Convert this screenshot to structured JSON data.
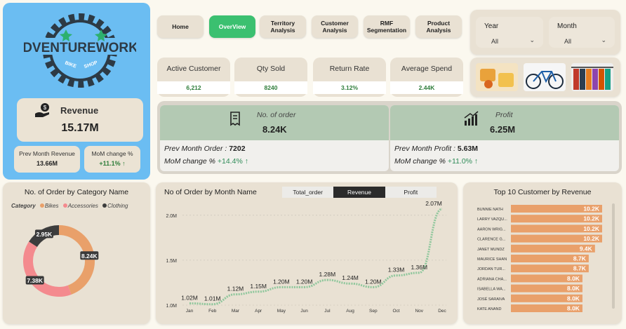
{
  "brand": {
    "logo_text": "ADVENTUREWORKS",
    "logo_sub_left": "BIKE",
    "logo_sub_right": "SHOP",
    "revenue_label": "Revenue",
    "revenue_value": "15.17M",
    "prev_month_label": "Prev Month Revenue",
    "prev_month_value": "13.66M",
    "mom_label": "MoM change %",
    "mom_value": "+11.1%",
    "mom_arrow": "↑"
  },
  "nav": [
    {
      "label": "Home"
    },
    {
      "label": "OverView"
    },
    {
      "label": "Territory Analysis"
    },
    {
      "label": "Customer Analysis"
    },
    {
      "label": "RMF Segmentation"
    },
    {
      "label": "Product Analysis"
    }
  ],
  "slicers": {
    "year_label": "Year",
    "year_value": "All",
    "month_label": "Month",
    "month_value": "All",
    "chevron": "⌄"
  },
  "kpis": [
    {
      "label": "Active Customer",
      "value": "6,212"
    },
    {
      "label": "Qty Sold",
      "value": "8240"
    },
    {
      "label": "Return Rate",
      "value": "3.12%"
    },
    {
      "label": "Average Spend",
      "value": "2.44K"
    }
  ],
  "orders": {
    "label": "No. of order",
    "value": "8.24K",
    "prev_label": "Prev Month Order :",
    "prev_value": "7202",
    "mom_label": "MoM change %",
    "mom_value": "+14.4%",
    "arrow": "↑"
  },
  "profit": {
    "label": "Profit",
    "value": "6.25M",
    "prev_label": "Prev Month Profit :",
    "prev_value": "5.63M",
    "mom_label": "MoM change %",
    "mom_value": "+11.0%",
    "arrow": "↑"
  },
  "donut": {
    "title": "No. of Order by Category Name",
    "legend_title": "Category",
    "colors": {
      "Bikes": "#e9a06a",
      "Accessories": "#f48a8e",
      "Clothing": "#3d3d3d"
    },
    "chart_data": {
      "type": "pie",
      "categories": [
        "Bikes",
        "Accessories",
        "Clothing"
      ],
      "values": [
        8.24,
        7.38,
        2.95
      ],
      "labels": [
        "8.24K",
        "7.38K",
        "2.95K"
      ],
      "donut": true
    }
  },
  "line": {
    "title": "No of Order by Month Name",
    "tabs": [
      {
        "label": "Total_order"
      },
      {
        "label": "Revenue"
      },
      {
        "label": "Profit"
      }
    ],
    "selected_tab": "Revenue",
    "color": "#8fc79c",
    "chart_data": {
      "type": "line",
      "x": [
        "Jan",
        "Feb",
        "Mar",
        "Apr",
        "May",
        "Jun",
        "Jul",
        "Aug",
        "Sep",
        "Oct",
        "Nov",
        "Dec"
      ],
      "values": [
        1.02,
        1.01,
        1.12,
        1.15,
        1.2,
        1.2,
        1.28,
        1.24,
        1.2,
        1.33,
        1.36,
        2.07
      ],
      "labels": [
        "1.02M",
        "1.01M",
        "1.12M",
        "1.15M",
        "1.20M",
        "1.20M",
        "1.28M",
        "1.24M",
        "1.20M",
        "1.33M",
        "1.36M",
        "2.07M"
      ],
      "yticks": [
        "1.0M",
        "1.5M",
        "2.0M"
      ],
      "ytick_values": [
        1.0,
        1.5,
        2.0
      ],
      "ylim": [
        1.0,
        2.1
      ],
      "grid": true
    }
  },
  "bars": {
    "title": "Top 10 Customer by Revenue",
    "color": "#e9a06a",
    "chart_data": {
      "type": "bar",
      "orientation": "horizontal",
      "categories": [
        "BUNNIE NATH",
        "LARRY VAZQU...",
        "AARON WRIG...",
        "CLARENCE G...",
        "JANET MUNDZ",
        "MAURICE SHAN",
        "JORDAN TUR...",
        "ADRIANA CHA...",
        "ISABELLA WA...",
        "JOSÉ SARAIVA",
        "KATE ANAND"
      ],
      "values": [
        10.2,
        10.2,
        10.2,
        10.2,
        9.4,
        8.7,
        8.7,
        8.0,
        8.0,
        8.0,
        8.0
      ],
      "labels": [
        "10.2K",
        "10.2K",
        "10.2K",
        "10.2K",
        "9.4K",
        "8.7K",
        "8.7K",
        "8.0K",
        "8.0K",
        "8.0K",
        "8.0K"
      ]
    }
  }
}
